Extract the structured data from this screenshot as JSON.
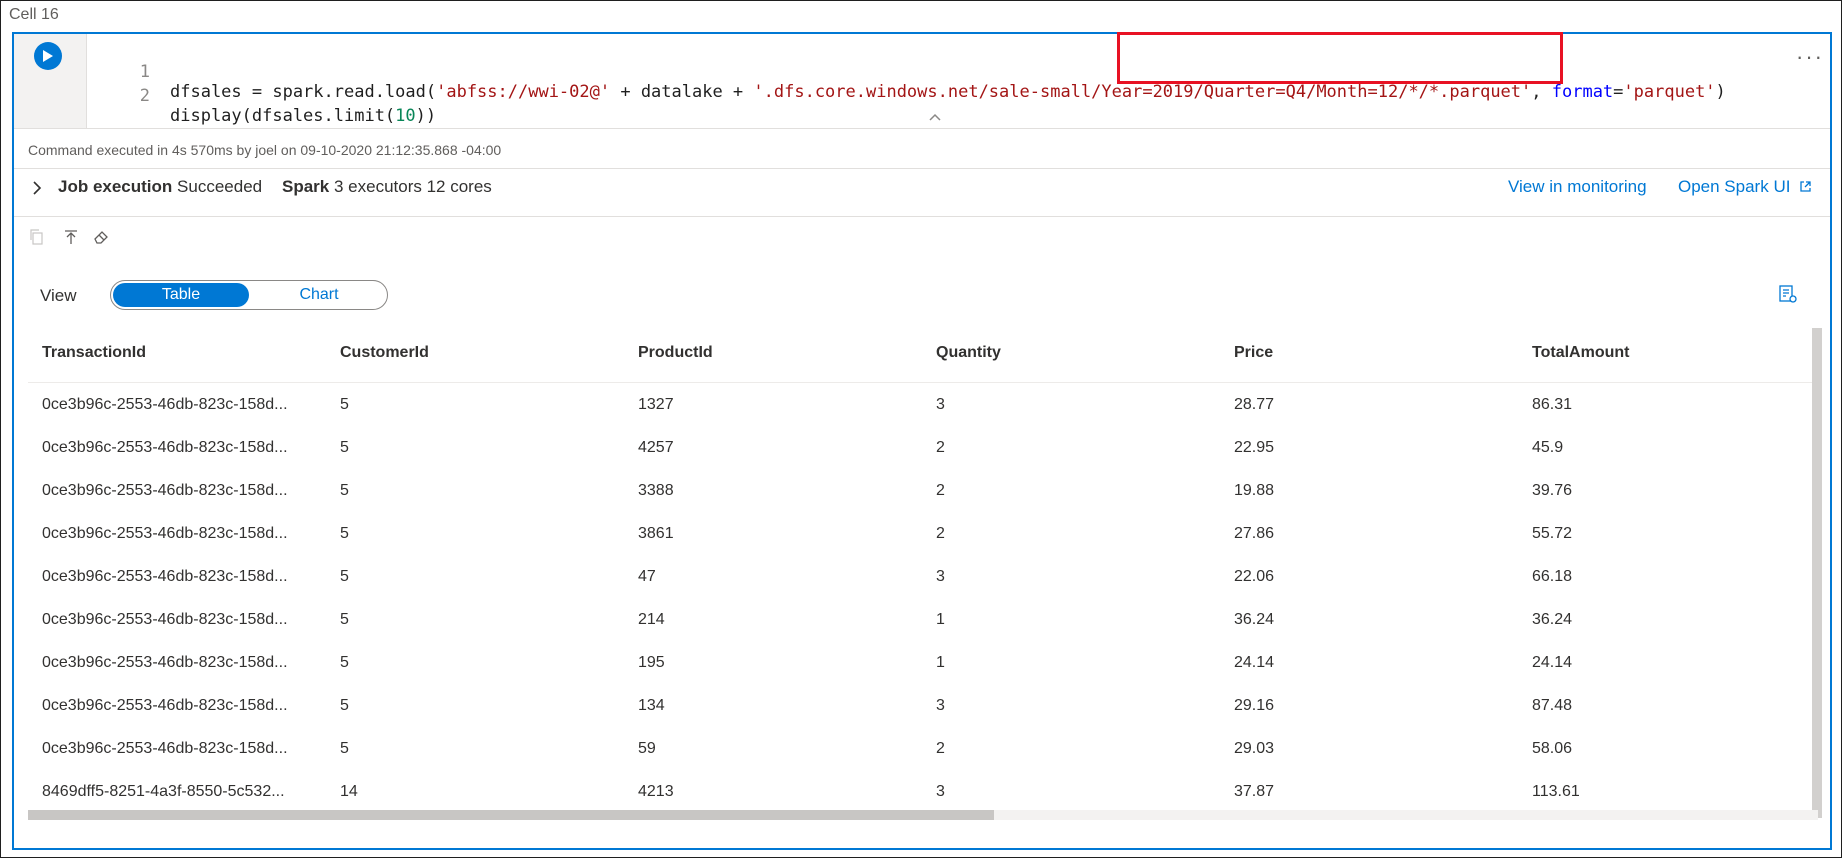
{
  "cell": {
    "label": "Cell 16"
  },
  "code": {
    "lines": [
      {
        "number": "1",
        "p1": "dfsales = spark.read.load(",
        "s1": "'abfss://wwi-02@'",
        "p2": " + datalake + ",
        "s2": "'.dfs.core.windows.net/sale-small/Year=2019/Quarter=Q4/Month=12/*/*.parquet'",
        "p3": ", ",
        "kw": "format",
        "p4": "=",
        "s3": "'parquet'",
        "p5": ")"
      },
      {
        "number": "2",
        "p1": "display(dfsales.limit(",
        "num": "10",
        "p2": "))"
      }
    ],
    "more_label": "···"
  },
  "execution": {
    "info": "Command executed in 4s 570ms by joel on 09-10-2020 21:12:35.868 -04:00"
  },
  "job": {
    "label": "Job execution",
    "status": "Succeeded",
    "spark_label": "Spark",
    "spark_info": "3 executors 12 cores",
    "monitoring_link": "View in monitoring",
    "spark_ui_link": "Open Spark UI"
  },
  "view": {
    "label": "View",
    "tabs": [
      "Table",
      "Chart"
    ],
    "selected": "Table"
  },
  "table": {
    "columns": [
      "TransactionId",
      "CustomerId",
      "ProductId",
      "Quantity",
      "Price",
      "TotalAmount"
    ],
    "rows": [
      [
        "0ce3b96c-2553-46db-823c-158d...",
        "5",
        "1327",
        "3",
        "28.77",
        "86.31"
      ],
      [
        "0ce3b96c-2553-46db-823c-158d...",
        "5",
        "4257",
        "2",
        "22.95",
        "45.9"
      ],
      [
        "0ce3b96c-2553-46db-823c-158d...",
        "5",
        "3388",
        "2",
        "19.88",
        "39.76"
      ],
      [
        "0ce3b96c-2553-46db-823c-158d...",
        "5",
        "3861",
        "2",
        "27.86",
        "55.72"
      ],
      [
        "0ce3b96c-2553-46db-823c-158d...",
        "5",
        "47",
        "3",
        "22.06",
        "66.18"
      ],
      [
        "0ce3b96c-2553-46db-823c-158d...",
        "5",
        "214",
        "1",
        "36.24",
        "36.24"
      ],
      [
        "0ce3b96c-2553-46db-823c-158d...",
        "5",
        "195",
        "1",
        "24.14",
        "24.14"
      ],
      [
        "0ce3b96c-2553-46db-823c-158d...",
        "5",
        "134",
        "3",
        "29.16",
        "87.48"
      ],
      [
        "0ce3b96c-2553-46db-823c-158d...",
        "5",
        "59",
        "2",
        "29.03",
        "58.06"
      ],
      [
        "8469dff5-8251-4a3f-8550-5c532...",
        "14",
        "4213",
        "3",
        "37.87",
        "113.61"
      ]
    ]
  },
  "colors": {
    "accent": "#0078d4",
    "highlight": "#e81123",
    "string": "#a31515",
    "keyword": "#0000ff",
    "number": "#098658"
  },
  "icons": [
    "run-icon",
    "more-icon",
    "chevron-up-icon",
    "chevron-right-icon",
    "external-link-icon",
    "copy-icon",
    "pin-icon",
    "eraser-icon",
    "chart-settings-icon"
  ]
}
